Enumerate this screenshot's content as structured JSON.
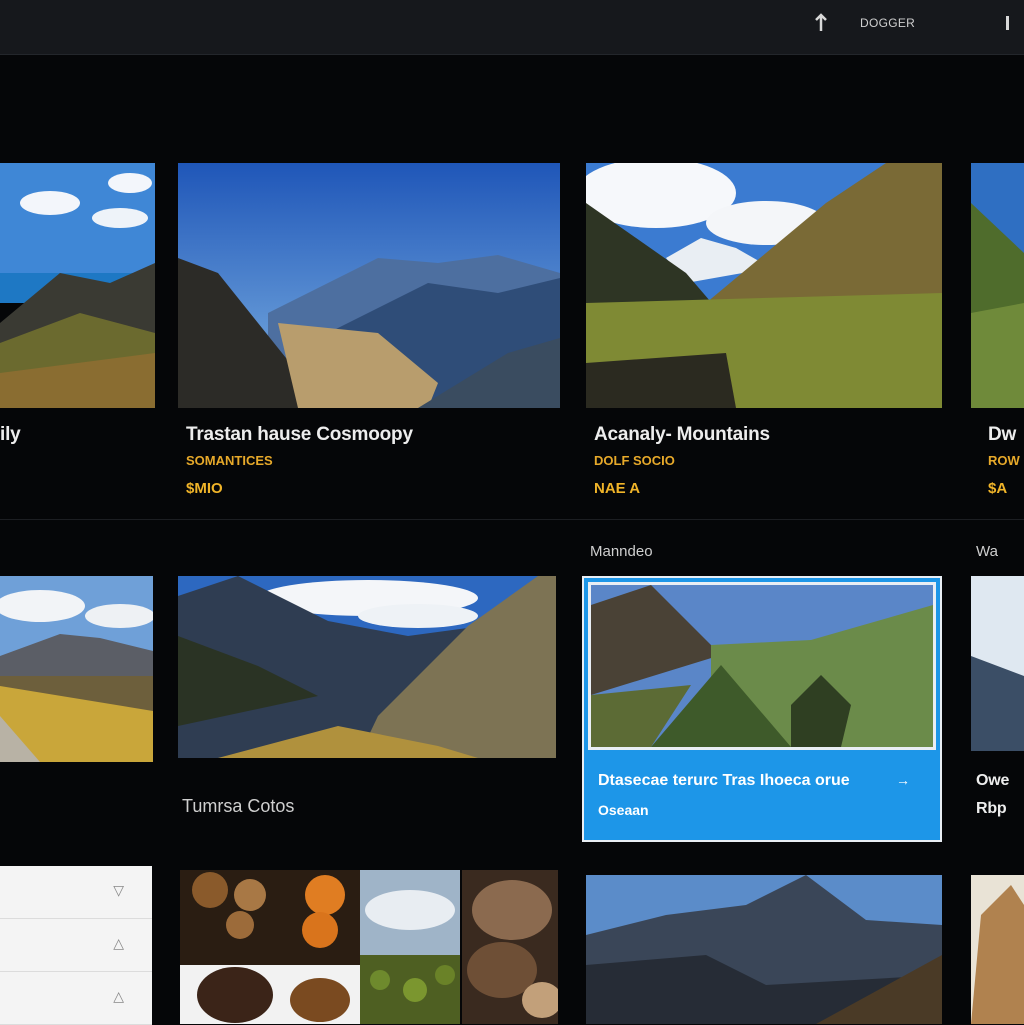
{
  "topbar": {
    "upload_icon": "upload-icon",
    "account_label": "DOGGER",
    "menu_icon": "menu-icon"
  },
  "row1": {
    "cards": [
      {
        "title": "ily",
        "subtitle": "",
        "price": ""
      },
      {
        "title": "Trastan hause Cosmoopy",
        "subtitle": "SOMANTICES",
        "price": "$MIO"
      },
      {
        "title": "Acanaly- Mountains",
        "subtitle": "DOLF SOCIO",
        "price": "NAE A"
      },
      {
        "title": "Dw",
        "subtitle": "ROW",
        "price": "$A"
      }
    ]
  },
  "row2": {
    "section_label_center": "Manndeo",
    "section_label_right": "Wa",
    "lower_label": "Tumrsa Cotos",
    "featured": {
      "title": "Dtasecae terurc  Tras  Ihoeca orue",
      "subtitle": "Oseaan",
      "arrow": "→"
    },
    "right_partial_title": "Owe",
    "right_partial_sub": "Rbp"
  },
  "row3": {
    "list_rows": [
      "",
      "",
      ""
    ]
  },
  "colors": {
    "accent_blue": "#1d96e8",
    "price_gold": "#f0b429",
    "background": "#050608"
  }
}
